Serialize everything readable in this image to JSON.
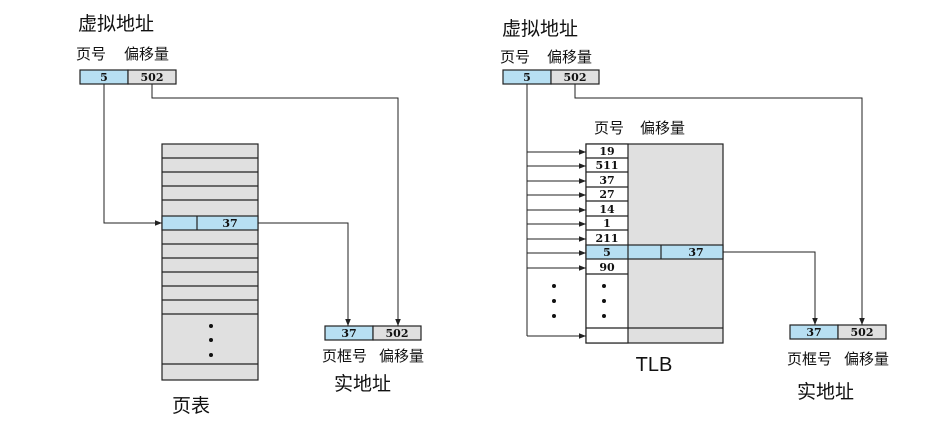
{
  "left": {
    "virtual_address_label": "虚拟地址",
    "page_number_label": "页号",
    "offset_label": "偏移量",
    "vpn": "5",
    "offset": "502",
    "pte_frame": "37",
    "page_table_label": "页表",
    "frame_label": "页框号",
    "phys_offset_label": "偏移量",
    "phys_frame": "37",
    "phys_offset": "502",
    "physical_address_label": "实地址"
  },
  "right": {
    "virtual_address_label": "虚拟地址",
    "page_number_label": "页号",
    "offset_label": "偏移量",
    "vpn": "5",
    "offset": "502",
    "tlb_page_label": "页号",
    "tlb_offset_label": "偏移量",
    "tlb_entries": [
      "19",
      "511",
      "37",
      "27",
      "14",
      "1",
      "211",
      "5",
      "90"
    ],
    "tlb_hit_frame": "37",
    "tlb_label": "TLB",
    "frame_label": "页框号",
    "phys_offset_label": "偏移量",
    "phys_frame": "37",
    "phys_offset": "502",
    "physical_address_label": "实地址"
  },
  "colors": {
    "highlight": "#b7dff2",
    "gray": "#e0e0e0",
    "white": "#ffffff",
    "line": "#222222"
  }
}
